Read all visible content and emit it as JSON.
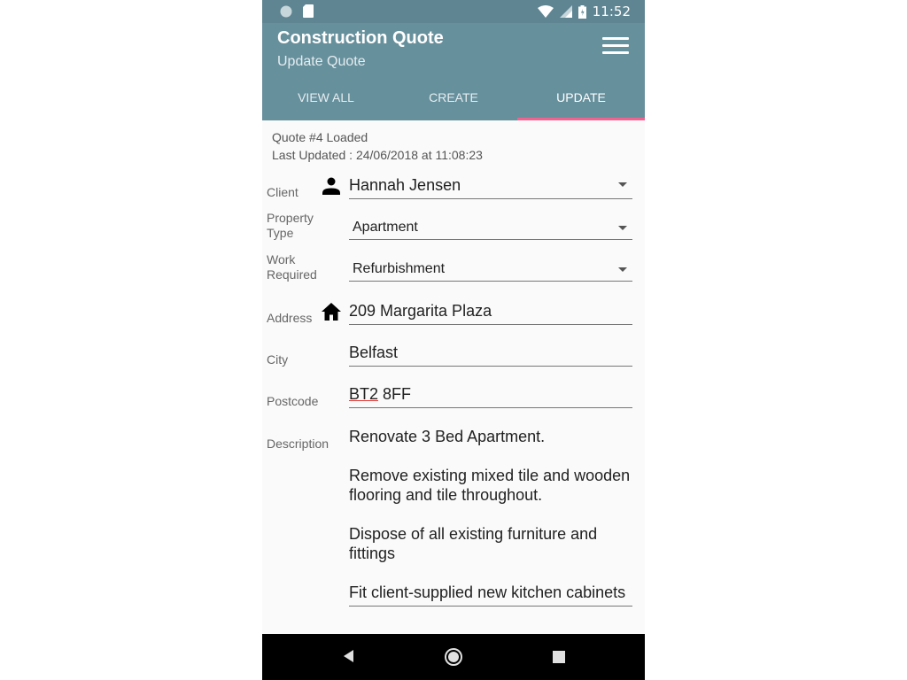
{
  "status_bar": {
    "time": "11:52",
    "icons": [
      "circle-notification-icon",
      "sd-card-icon",
      "wifi-icon",
      "cell-signal-icon",
      "battery-icon"
    ]
  },
  "app_bar": {
    "title": "Construction Quote",
    "subtitle": "Update Quote",
    "menu_icon": "hamburger-menu-icon"
  },
  "tabs": [
    {
      "label": "VIEW ALL",
      "active": false
    },
    {
      "label": "CREATE",
      "active": false
    },
    {
      "label": "UPDATE",
      "active": true
    }
  ],
  "quote_info": {
    "loaded": "Quote #4 Loaded",
    "last_updated": "Last Updated : 24/06/2018 at 11:08:23"
  },
  "form": {
    "client": {
      "label": "Client",
      "value": "Hannah Jensen",
      "icon": "person-icon"
    },
    "property_type": {
      "label_line1": "Property",
      "label_line2": "Type",
      "value": "Apartment"
    },
    "work_required": {
      "label_line1": "Work",
      "label_line2": "Required",
      "value": "Refurbishment"
    },
    "address": {
      "label": "Address",
      "value": "209 Margarita Plaza",
      "icon": "home-icon"
    },
    "city": {
      "label": "City",
      "value": "Belfast"
    },
    "postcode": {
      "label": "Postcode",
      "value_part1": "BT2",
      "value_part2": " 8FF"
    },
    "description": {
      "label": "Description",
      "paragraphs": [
        "Renovate 3 Bed Apartment.",
        "Remove existing mixed tile and wooden flooring and tile throughout.",
        "Dispose of all existing furniture and fittings",
        "Fit client-supplied new kitchen cabinets"
      ]
    }
  },
  "colors": {
    "status_bar": "#5f8592",
    "app_bar": "#67909d",
    "tab_indicator": "#f0628f",
    "nav_bar": "#000000"
  },
  "nav_bar": {
    "buttons": [
      "back-icon",
      "home-button-icon",
      "recent-apps-icon"
    ]
  }
}
